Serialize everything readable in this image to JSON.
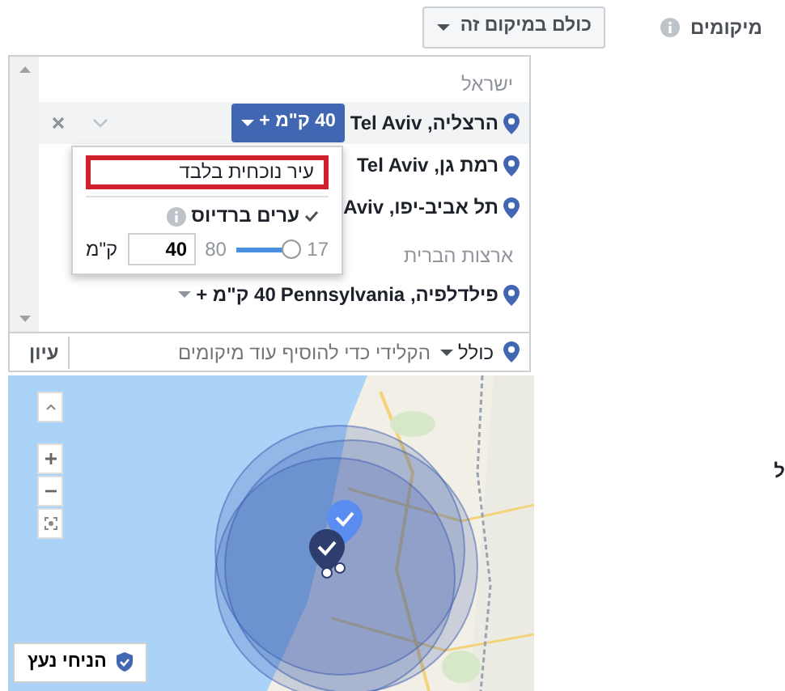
{
  "field_label": "מיקומים",
  "audience_dropdown": {
    "label": "כולם במיקום זה"
  },
  "location_groups": [
    {
      "country": "ישראל",
      "locations": [
        {
          "name": "הרצליה, Tel Aviv",
          "radius": "40 ק\"מ +",
          "selected": true
        },
        {
          "name": "רמת גן, Tel Aviv",
          "selected": false
        },
        {
          "name": "תל אביב-יפו, Aviv",
          "selected": false
        }
      ]
    },
    {
      "country": "ארצות הברית",
      "locations": [
        {
          "name": "פילדלפיה, Pennsylvania",
          "radius": "40 ק\"מ +",
          "selected": false
        }
      ]
    }
  ],
  "radius_popup": {
    "options": [
      {
        "label": "עיר נוכחית בלבד",
        "checked": false,
        "highlighted": true,
        "info": false
      },
      {
        "label": "ערים ברדיוס",
        "checked": true,
        "highlighted": false,
        "info": true
      }
    ],
    "slider": {
      "min": "17",
      "max": "80",
      "level": 0.9,
      "value": "40",
      "unit": "ק\"מ"
    }
  },
  "add_location": {
    "include": "כולל",
    "placeholder": "הקלידי כדי להוסיף עוד מיקומים",
    "browse": "עיון"
  },
  "map": {
    "kind": "picture",
    "drop_pin": "הניחי נעץ"
  },
  "edge_text": "ל"
}
